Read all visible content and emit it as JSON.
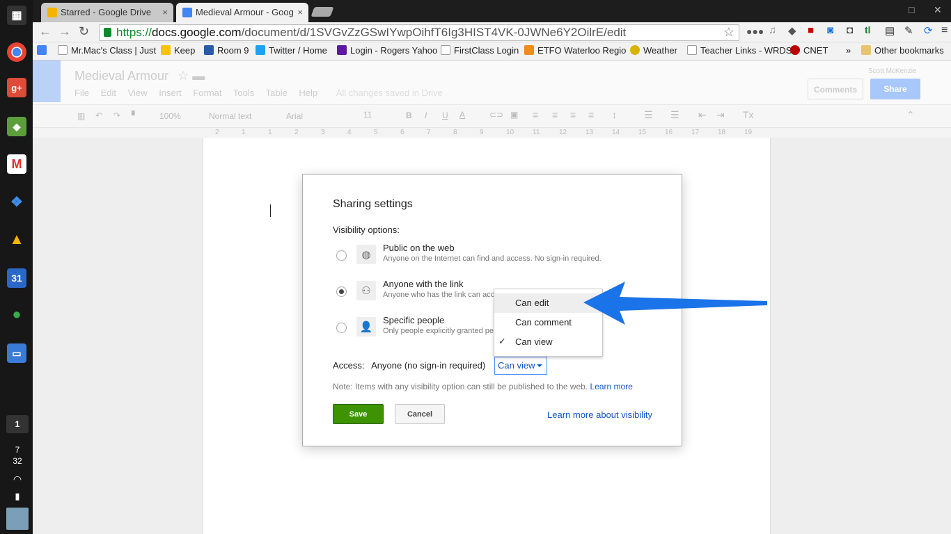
{
  "shelf": {
    "apps": [
      "apps-launcher-icon",
      "chrome-icon",
      "google-plus-icon",
      "evernote-icon",
      "gmail-icon",
      "dropbox-icon",
      "google-drive-icon",
      "calendar-icon",
      "hangouts-icon",
      "files-icon"
    ],
    "calendar_day": "31",
    "workspace": "1",
    "time_hour": "7",
    "time_min": "32"
  },
  "tabs": [
    {
      "title": "Starred - Google Drive",
      "close": "×"
    },
    {
      "title": "Medieval Armour - Goog",
      "close": "×"
    }
  ],
  "window": {
    "maximize": "□",
    "close": "✕"
  },
  "omnibox": {
    "scheme": "https://",
    "host": "docs.google.com",
    "path": "/document/d/1SVGvZzGSwIYwpOihfT6Ig3HIST4VK-0JWNe6Y2OilrE/edit"
  },
  "bookmarks": {
    "items": [
      "Mr.Mac's Class | Just",
      "Keep",
      "Room 9",
      "Twitter / Home",
      "Login - Rogers Yahoo",
      "FirstClass Login",
      "ETFO Waterloo Regio",
      "Weather",
      "Teacher Links - WRDS",
      "CNET"
    ],
    "more": "»",
    "other": "Other bookmarks"
  },
  "document": {
    "title": "Medieval Armour",
    "menu": [
      "File",
      "Edit",
      "View",
      "Insert",
      "Format",
      "Tools",
      "Table",
      "Help"
    ],
    "saved_status": "All changes saved in Drive",
    "user": "Scott McKenzie",
    "comments": "Comments",
    "share": "Share",
    "zoom": "100%",
    "style": "Normal text",
    "font": "Arial",
    "size": "11",
    "ruler": [
      "2",
      "1",
      "1",
      "2",
      "3",
      "4",
      "5",
      "6",
      "7",
      "8",
      "9",
      "10",
      "11",
      "12",
      "13",
      "14",
      "15",
      "16",
      "17",
      "18",
      "19"
    ]
  },
  "dialog": {
    "title": "Sharing settings",
    "visibility_label": "Visibility options:",
    "options": [
      {
        "title": "Public on the web",
        "desc": "Anyone on the Internet can find and access. No sign-in required.",
        "icon": "globe-icon",
        "checked": false
      },
      {
        "title": "Anyone with the link",
        "desc": "Anyone who has the link can acc",
        "icon": "link-person-icon",
        "checked": true
      },
      {
        "title": "Specific people",
        "desc": "Only people explicitly granted per",
        "icon": "people-icon",
        "checked": false
      }
    ],
    "access_label": "Access:",
    "access_value": "Anyone (no sign-in required)",
    "permission": "Can view",
    "note": "Note: Items with any visibility option can still be published to the web.",
    "note_link": "Learn more",
    "save": "Save",
    "cancel": "Cancel",
    "learn_more_visibility": "Learn more about visibility"
  },
  "permission_menu": {
    "items": [
      {
        "label": "Can edit",
        "highlighted": true,
        "checked": false
      },
      {
        "label": "Can comment",
        "highlighted": false,
        "checked": false
      },
      {
        "label": "Can view",
        "highlighted": false,
        "checked": true
      }
    ],
    "check": "✓"
  },
  "colors": {
    "accent": "#4285f4",
    "save_green": "#3d9400",
    "link": "#1155cc",
    "arrow": "#1a73e8"
  }
}
